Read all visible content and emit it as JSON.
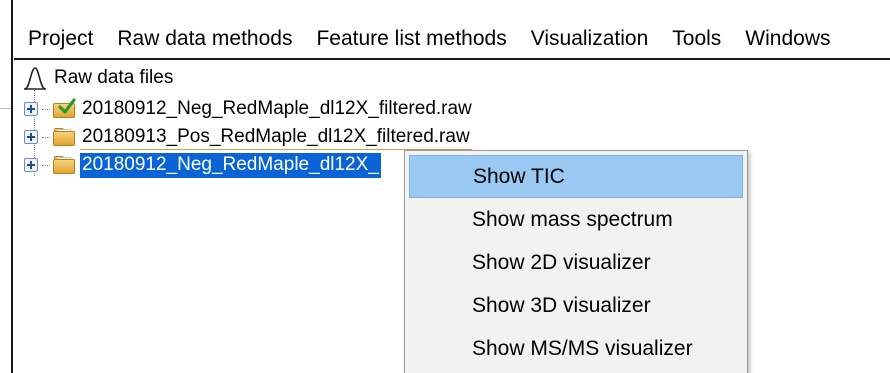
{
  "menubar": {
    "items": [
      "Project",
      "Raw data methods",
      "Feature list methods",
      "Visualization",
      "Tools",
      "Windows"
    ]
  },
  "tree": {
    "root_label": "Raw data files",
    "root_icon": "chromatogram-peak-icon",
    "files": [
      {
        "label": "20180912_Neg_RedMaple_dl12X_filtered.raw",
        "icon": "folder-checked-icon",
        "selected": false
      },
      {
        "label": "20180913_Pos_RedMaple_dl12X_filtered.raw",
        "icon": "folder-icon",
        "selected": false
      },
      {
        "label": "20180912_Neg_RedMaple_dl12X_",
        "icon": "folder-icon",
        "selected": true
      }
    ]
  },
  "context_menu": {
    "items": [
      "Show TIC",
      "Show mass spectrum",
      "Show 2D visualizer",
      "Show 3D visualizer",
      "Show MS/MS visualizer"
    ],
    "highlighted": "Show TIC",
    "highlight_color": "#99c9f2"
  },
  "colors": {
    "selection": "#0a64d6",
    "menu_background": "#f2f2f2"
  }
}
